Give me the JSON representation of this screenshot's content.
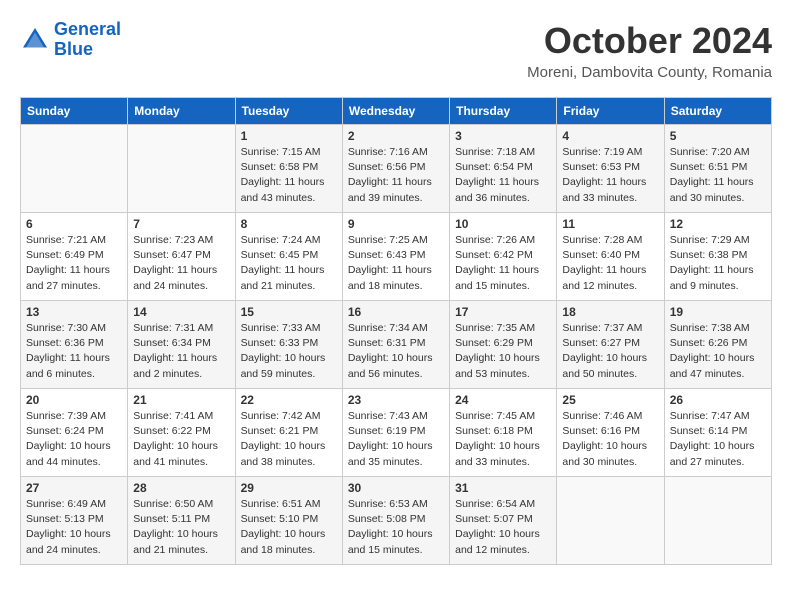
{
  "header": {
    "logo_line1": "General",
    "logo_line2": "Blue",
    "month": "October 2024",
    "location": "Moreni, Dambovita County, Romania"
  },
  "days_of_week": [
    "Sunday",
    "Monday",
    "Tuesday",
    "Wednesday",
    "Thursday",
    "Friday",
    "Saturday"
  ],
  "weeks": [
    [
      {
        "day": "",
        "info": ""
      },
      {
        "day": "",
        "info": ""
      },
      {
        "day": "1",
        "info": "Sunrise: 7:15 AM\nSunset: 6:58 PM\nDaylight: 11 hours and 43 minutes."
      },
      {
        "day": "2",
        "info": "Sunrise: 7:16 AM\nSunset: 6:56 PM\nDaylight: 11 hours and 39 minutes."
      },
      {
        "day": "3",
        "info": "Sunrise: 7:18 AM\nSunset: 6:54 PM\nDaylight: 11 hours and 36 minutes."
      },
      {
        "day": "4",
        "info": "Sunrise: 7:19 AM\nSunset: 6:53 PM\nDaylight: 11 hours and 33 minutes."
      },
      {
        "day": "5",
        "info": "Sunrise: 7:20 AM\nSunset: 6:51 PM\nDaylight: 11 hours and 30 minutes."
      }
    ],
    [
      {
        "day": "6",
        "info": "Sunrise: 7:21 AM\nSunset: 6:49 PM\nDaylight: 11 hours and 27 minutes."
      },
      {
        "day": "7",
        "info": "Sunrise: 7:23 AM\nSunset: 6:47 PM\nDaylight: 11 hours and 24 minutes."
      },
      {
        "day": "8",
        "info": "Sunrise: 7:24 AM\nSunset: 6:45 PM\nDaylight: 11 hours and 21 minutes."
      },
      {
        "day": "9",
        "info": "Sunrise: 7:25 AM\nSunset: 6:43 PM\nDaylight: 11 hours and 18 minutes."
      },
      {
        "day": "10",
        "info": "Sunrise: 7:26 AM\nSunset: 6:42 PM\nDaylight: 11 hours and 15 minutes."
      },
      {
        "day": "11",
        "info": "Sunrise: 7:28 AM\nSunset: 6:40 PM\nDaylight: 11 hours and 12 minutes."
      },
      {
        "day": "12",
        "info": "Sunrise: 7:29 AM\nSunset: 6:38 PM\nDaylight: 11 hours and 9 minutes."
      }
    ],
    [
      {
        "day": "13",
        "info": "Sunrise: 7:30 AM\nSunset: 6:36 PM\nDaylight: 11 hours and 6 minutes."
      },
      {
        "day": "14",
        "info": "Sunrise: 7:31 AM\nSunset: 6:34 PM\nDaylight: 11 hours and 2 minutes."
      },
      {
        "day": "15",
        "info": "Sunrise: 7:33 AM\nSunset: 6:33 PM\nDaylight: 10 hours and 59 minutes."
      },
      {
        "day": "16",
        "info": "Sunrise: 7:34 AM\nSunset: 6:31 PM\nDaylight: 10 hours and 56 minutes."
      },
      {
        "day": "17",
        "info": "Sunrise: 7:35 AM\nSunset: 6:29 PM\nDaylight: 10 hours and 53 minutes."
      },
      {
        "day": "18",
        "info": "Sunrise: 7:37 AM\nSunset: 6:27 PM\nDaylight: 10 hours and 50 minutes."
      },
      {
        "day": "19",
        "info": "Sunrise: 7:38 AM\nSunset: 6:26 PM\nDaylight: 10 hours and 47 minutes."
      }
    ],
    [
      {
        "day": "20",
        "info": "Sunrise: 7:39 AM\nSunset: 6:24 PM\nDaylight: 10 hours and 44 minutes."
      },
      {
        "day": "21",
        "info": "Sunrise: 7:41 AM\nSunset: 6:22 PM\nDaylight: 10 hours and 41 minutes."
      },
      {
        "day": "22",
        "info": "Sunrise: 7:42 AM\nSunset: 6:21 PM\nDaylight: 10 hours and 38 minutes."
      },
      {
        "day": "23",
        "info": "Sunrise: 7:43 AM\nSunset: 6:19 PM\nDaylight: 10 hours and 35 minutes."
      },
      {
        "day": "24",
        "info": "Sunrise: 7:45 AM\nSunset: 6:18 PM\nDaylight: 10 hours and 33 minutes."
      },
      {
        "day": "25",
        "info": "Sunrise: 7:46 AM\nSunset: 6:16 PM\nDaylight: 10 hours and 30 minutes."
      },
      {
        "day": "26",
        "info": "Sunrise: 7:47 AM\nSunset: 6:14 PM\nDaylight: 10 hours and 27 minutes."
      }
    ],
    [
      {
        "day": "27",
        "info": "Sunrise: 6:49 AM\nSunset: 5:13 PM\nDaylight: 10 hours and 24 minutes."
      },
      {
        "day": "28",
        "info": "Sunrise: 6:50 AM\nSunset: 5:11 PM\nDaylight: 10 hours and 21 minutes."
      },
      {
        "day": "29",
        "info": "Sunrise: 6:51 AM\nSunset: 5:10 PM\nDaylight: 10 hours and 18 minutes."
      },
      {
        "day": "30",
        "info": "Sunrise: 6:53 AM\nSunset: 5:08 PM\nDaylight: 10 hours and 15 minutes."
      },
      {
        "day": "31",
        "info": "Sunrise: 6:54 AM\nSunset: 5:07 PM\nDaylight: 10 hours and 12 minutes."
      },
      {
        "day": "",
        "info": ""
      },
      {
        "day": "",
        "info": ""
      }
    ]
  ]
}
